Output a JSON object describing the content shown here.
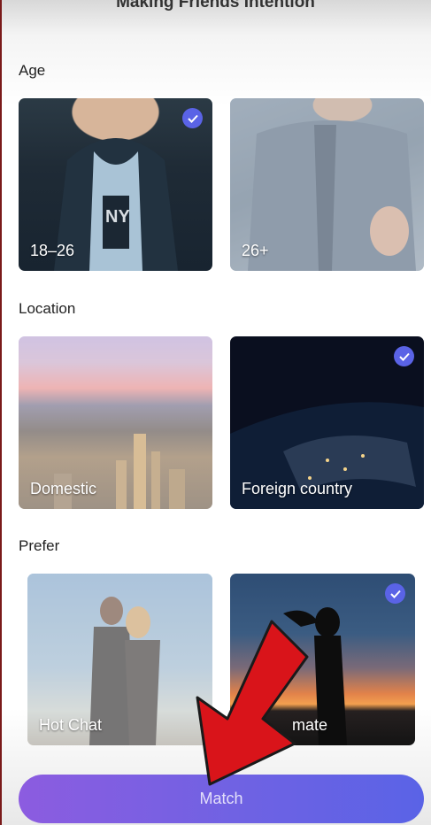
{
  "header": {
    "title": "Making Friends Intention"
  },
  "sections": {
    "age": {
      "label": "Age",
      "options": [
        {
          "label": "18–26",
          "selected": true
        },
        {
          "label": "26+",
          "selected": false
        }
      ]
    },
    "location": {
      "label": "Location",
      "options": [
        {
          "label": "Domestic",
          "selected": false
        },
        {
          "label": "Foreign country",
          "selected": true
        }
      ]
    },
    "prefer": {
      "label": "Prefer",
      "options": [
        {
          "label": "Hot Chat",
          "selected": false
        },
        {
          "label": "mate",
          "selected": true
        }
      ]
    }
  },
  "match_button": {
    "label": "Match"
  },
  "colors": {
    "accent": "#5a63e6",
    "button_start": "#8c5ce0",
    "annotation_arrow": "#d9141a"
  }
}
